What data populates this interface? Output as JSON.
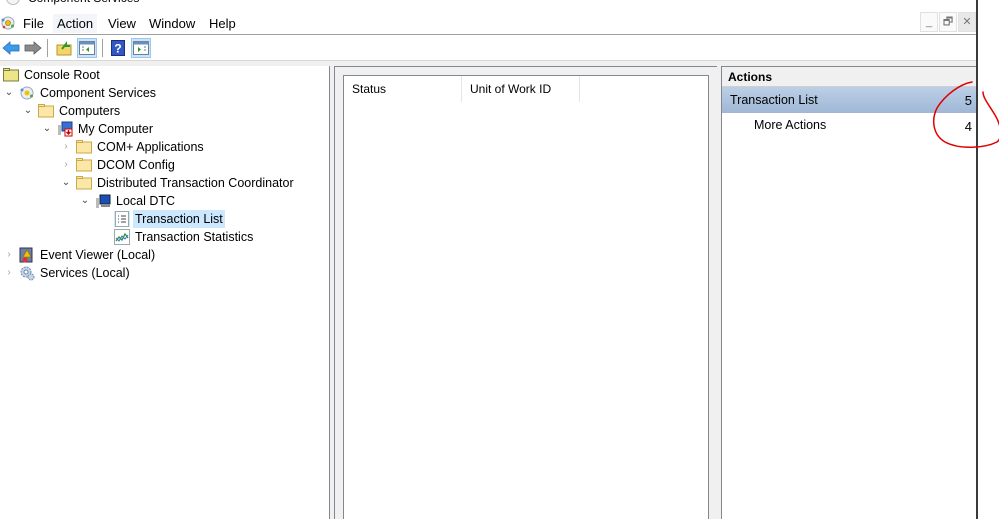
{
  "window": {
    "title": "Component Services"
  },
  "menu": {
    "items": [
      "File",
      "Action",
      "View",
      "Window",
      "Help"
    ]
  },
  "mdi_controls": {
    "minimize": "_",
    "restore": "🗗",
    "close": "✕"
  },
  "toolbar": {
    "buttons": [
      {
        "name": "back",
        "icon": "back-arrow-icon"
      },
      {
        "name": "forward",
        "icon": "forward-arrow-icon"
      },
      {
        "name": "up-one-level",
        "icon": "up-folder-icon"
      },
      {
        "name": "show-hide-console-tree",
        "icon": "console-tree-icon"
      },
      {
        "name": "help",
        "icon": "help-icon"
      },
      {
        "name": "show-hide-action-pane",
        "icon": "action-pane-icon"
      }
    ]
  },
  "tree": {
    "items": [
      {
        "label": "Console Root",
        "level": 0,
        "expander": "none",
        "icon": "folder-icon"
      },
      {
        "label": "Component Services",
        "level": 1,
        "expander": "expanded",
        "icon": "component-services-icon"
      },
      {
        "label": "Computers",
        "level": 2,
        "expander": "expanded",
        "icon": "folder-icon"
      },
      {
        "label": "My Computer",
        "level": 3,
        "expander": "expanded",
        "icon": "my-computer-icon"
      },
      {
        "label": "COM+ Applications",
        "level": 4,
        "expander": "collapsed",
        "icon": "folder-icon"
      },
      {
        "label": "DCOM Config",
        "level": 4,
        "expander": "collapsed",
        "icon": "folder-icon"
      },
      {
        "label": "Distributed Transaction Coordinator",
        "level": 4,
        "expander": "expanded",
        "icon": "folder-icon"
      },
      {
        "label": "Local DTC",
        "level": 5,
        "expander": "expanded",
        "icon": "local-dtc-icon"
      },
      {
        "label": "Transaction List",
        "level": 6,
        "expander": "none",
        "icon": "list-icon",
        "selected": true
      },
      {
        "label": "Transaction Statistics",
        "level": 6,
        "expander": "none",
        "icon": "statistics-icon"
      },
      {
        "label": "Event Viewer (Local)",
        "level": 1,
        "expander": "collapsed",
        "icon": "event-viewer-icon"
      },
      {
        "label": "Services (Local)",
        "level": 1,
        "expander": "collapsed",
        "icon": "services-icon"
      }
    ]
  },
  "list_view": {
    "columns": [
      "Status",
      "Unit of Work ID",
      ""
    ]
  },
  "actions": {
    "title": "Actions",
    "group_label": "Transaction List",
    "group_count": "5",
    "item_label": "More Actions",
    "item_count": "4"
  },
  "annotation": {
    "color": "#e00000",
    "description": "red hand-drawn circle around counts"
  },
  "colors": {
    "selection": "#cce8ff",
    "action_group": "#aec4e0",
    "pane_border": "#828790"
  }
}
